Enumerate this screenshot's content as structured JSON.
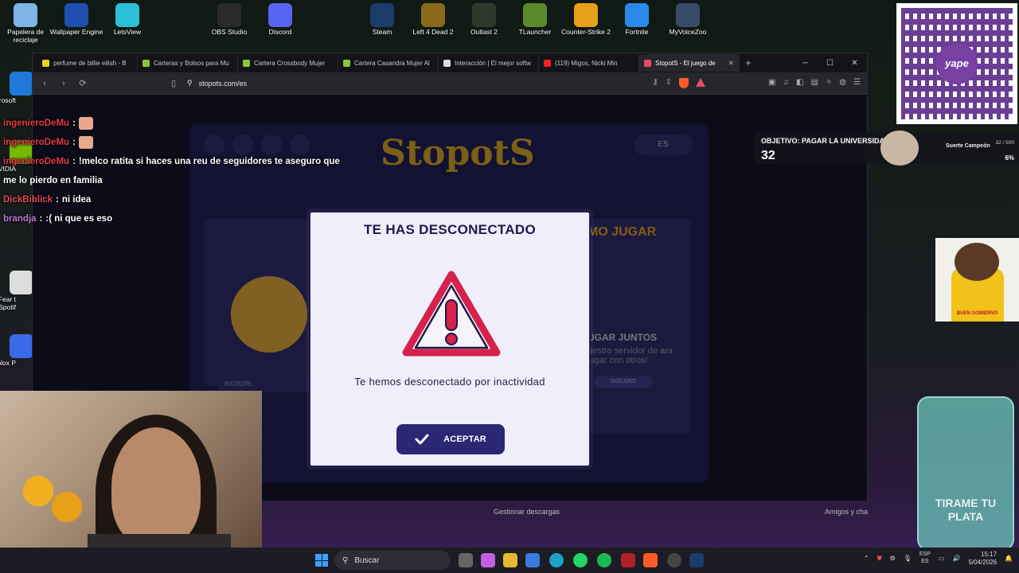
{
  "desktop_icons": [
    {
      "label": "Papelera de reciclaje",
      "icon": "recycle-bin-icon",
      "color": "#7fb4e6"
    },
    {
      "label": "Wallpaper Engine",
      "icon": "wallpaper-engine-icon",
      "color": "#1f4fb0"
    },
    {
      "label": "LetsView",
      "icon": "letsview-icon",
      "color": "#2cbfd8"
    },
    {
      "label": "OBS Studio",
      "icon": "obs-icon",
      "color": "#2a2a2a"
    },
    {
      "label": "Discord",
      "icon": "discord-icon",
      "color": "#5865f2"
    },
    {
      "label": "Steam",
      "icon": "steam-icon",
      "color": "#1b3b6a"
    },
    {
      "label": "Left 4 Dead 2",
      "icon": "left4dead2-icon",
      "color": "#8a6a1a"
    },
    {
      "label": "Outlast 2",
      "icon": "outlast2-icon",
      "color": "#2c3a2a"
    },
    {
      "label": "TLauncher",
      "icon": "tlauncher-icon",
      "color": "#5a8a2a"
    },
    {
      "label": "Counter-Strike 2",
      "icon": "cs2-icon",
      "color": "#e8a018"
    },
    {
      "label": "Fortnite",
      "icon": "fortnite-icon",
      "color": "#2a8ae8"
    },
    {
      "label": "MyVoiceZoo",
      "icon": "myvoicezoo-icon",
      "color": "#3a4a6a"
    }
  ],
  "left_icons": [
    {
      "label": "crosoft"
    },
    {
      "label": "IVIDIA"
    },
    {
      "label": "Fear t Spotif"
    },
    {
      "label": "oblox P"
    }
  ],
  "browser": {
    "tabs": [
      {
        "label": "perfume de billie eilish - B",
        "fav": "#e8d21a"
      },
      {
        "label": "Carteras y Bolsos para Mu",
        "fav": "#8ac63a"
      },
      {
        "label": "Cartera Crossbody Mujer",
        "fav": "#8ac63a"
      },
      {
        "label": "Cartera Casandra Mujer Al",
        "fav": "#8ac63a"
      },
      {
        "label": "Interacción | El mejor softw",
        "fav": "#dddddd"
      },
      {
        "label": "(119) Migos, Nicki Min",
        "fav": "#ff2020"
      },
      {
        "label": "StopotS - El juego de",
        "fav": "#e84a6a"
      }
    ],
    "url": "stopots.com/es",
    "download_manager": "Gestionar descargas",
    "friends": "Amigos y cha"
  },
  "site": {
    "logo": "StopotS",
    "lang": "ES",
    "how_to_play": "MO JUGAR",
    "play_together": "UGAR JUNTOS",
    "server": "uestro servidor de ara jugar con otros!",
    "discord": "DISCORD",
    "nickname_placeholder": "RATADRI"
  },
  "modal": {
    "title": "TE HAS DESCONECTADO",
    "message": "Te hemos desconectado por inactividad",
    "accept_label": "ACEPTAR",
    "warning_color": "#d6224a"
  },
  "chat": [
    {
      "user": "ingenieroDeMu",
      "sep": " :",
      "msg": "",
      "emote": true
    },
    {
      "user": "ingenieroDeMu",
      "sep": " :",
      "msg": "",
      "emote": true
    },
    {
      "user": "ingenieroDeMu",
      "sep": " :",
      "msg": " !melco ratita si haces una reu de seguidores te aseguro que"
    },
    {
      "user": "",
      "sep": "",
      "msg": "me lo pierdo en familia"
    },
    {
      "user": "DickBiblick",
      "sep": " :",
      "msg": " ni idea"
    },
    {
      "user": "brandja",
      "sep": " :",
      "msg": " :( ni que es eso"
    }
  ],
  "overlays": {
    "qr_brand": "yape",
    "goal_title": "OBJETIVO: PAGAR LA UNIVERSIDAD",
    "goal_value": "32",
    "goal_sub": "Suerte Campeón",
    "goal_count": "32 / 500",
    "goal_pct": "6%",
    "dog_label": "BUEN GOBIERNO",
    "jar_text": "TIRAME TU PLATA"
  },
  "taskbar": {
    "search": "Buscar",
    "lang_top": "ESP",
    "lang_bottom": "ES",
    "time": "15:17",
    "date": "5/04/2026"
  }
}
